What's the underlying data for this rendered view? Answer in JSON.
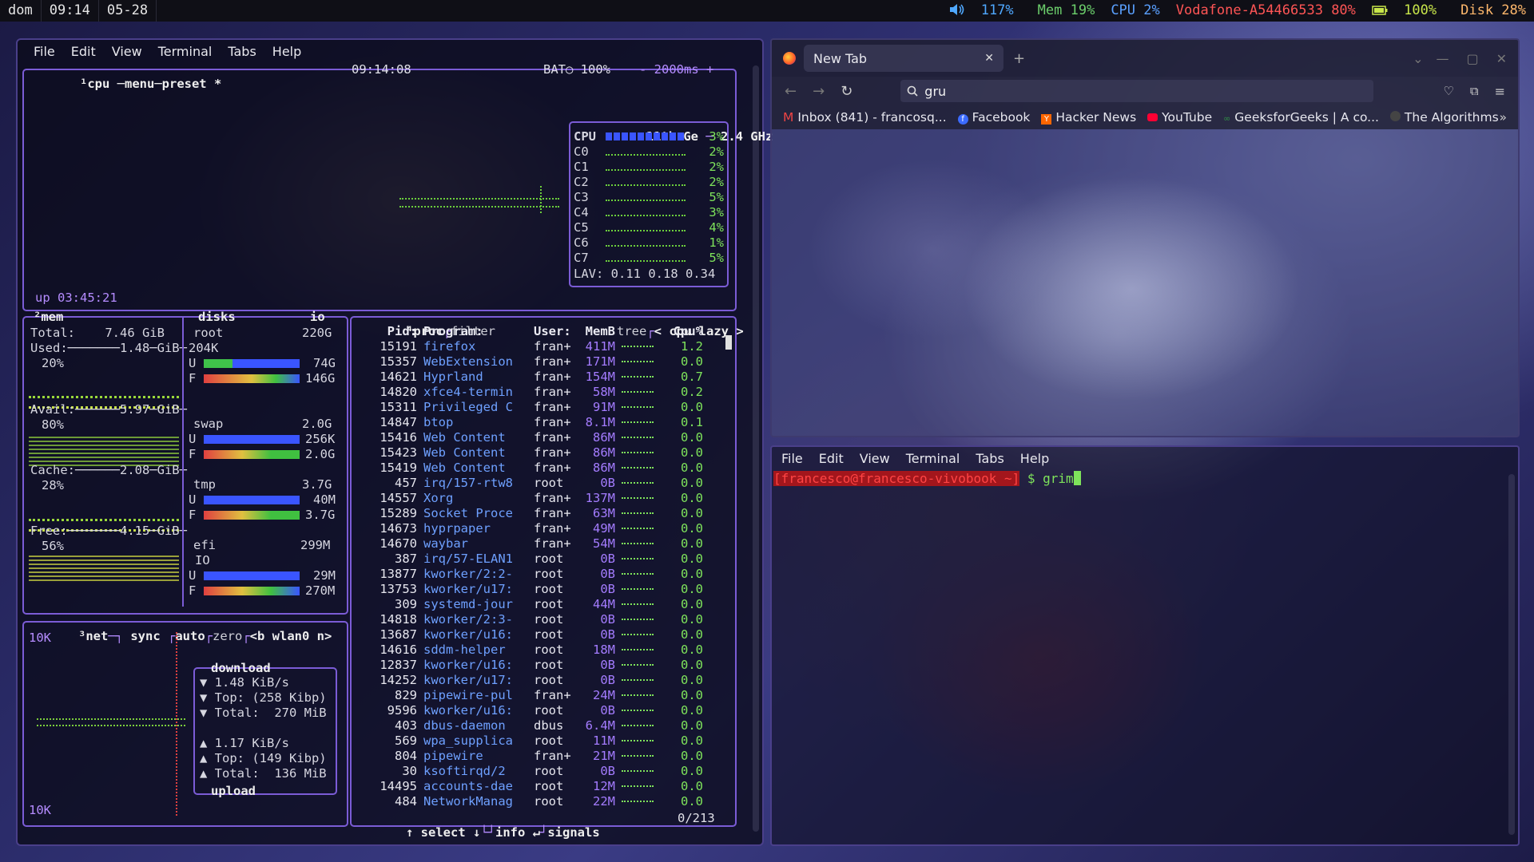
{
  "topbar": {
    "workspace": "dom",
    "time": "09:14",
    "date": "05-28",
    "volume": "117%",
    "mem": "Mem 19%",
    "cpu": "CPU  2%",
    "wifi": "Vodafone-A54466533 80%",
    "battery": "100%",
    "disk": "Disk 28%",
    "colors": {
      "volume": "#4fa8ff",
      "mem": "#6ccf6c",
      "cpu": "#5aa0ff",
      "wifi": "#ff5555",
      "battery": "#c8e64a",
      "disk": "#ffb86c"
    }
  },
  "term1": {
    "menu": [
      "File",
      "Edit",
      "View",
      "Terminal",
      "Tabs",
      "Help"
    ],
    "cpu_box": {
      "header": "¹cpu ─menu─preset *",
      "clock": "09:14:08",
      "bat": "BAT○ 100%",
      "interval": "- 2000ms +",
      "uptime": "up 03:45:21",
      "cpu_name": "11th Ge",
      "freq": "2.4 GHz",
      "cores": [
        {
          "name": "CPU",
          "pct": "3%"
        },
        {
          "name": "C0",
          "pct": "2%"
        },
        {
          "name": "C1",
          "pct": "2%"
        },
        {
          "name": "C2",
          "pct": "2%"
        },
        {
          "name": "C3",
          "pct": "5%"
        },
        {
          "name": "C4",
          "pct": "3%"
        },
        {
          "name": "C5",
          "pct": "4%"
        },
        {
          "name": "C6",
          "pct": "1%"
        },
        {
          "name": "C7",
          "pct": "5%"
        }
      ],
      "lav": "LAV: 0.11 0.18 0.34"
    },
    "mem_box": {
      "title": "²mem",
      "total": "Total:    7.46 GiB",
      "used": "Used:───────1.48─GiB─",
      "used_pct": "20%",
      "avail": "Avail:──────5.97─GiB─",
      "avail_pct": "80%",
      "cache": "Cache:──────2.08─GiB─",
      "cache_pct": "28%",
      "free": "Free:───────4.15─GiB─",
      "free_pct": "56%"
    },
    "disks_box": {
      "title": "disks",
      "io": "io",
      "root": "root",
      "root_size": "220G",
      "root_io": "204K",
      "root_u": "74G",
      "root_f": "146G",
      "swap": "swap",
      "swap_size": "2.0G",
      "swap_u": "256K",
      "swap_f": "2.0G",
      "tmp": "tmp",
      "tmp_size": "3.7G",
      "tmp_u": "40M",
      "tmp_f": "3.7G",
      "efi": "efi",
      "efi_size": "299M",
      "efi_io": "IO",
      "efi_u": "29M",
      "efi_f": "270M"
    },
    "net_box": {
      "header": "³net",
      "sync": "sync",
      "auto": "auto",
      "zero": "zero",
      "iface": "<b wlan0 n>",
      "scale_top": "10K",
      "scale_bottom": "10K",
      "download": "download",
      "dl_rate": "▼ 1.48 KiB/s",
      "dl_top": "▼ Top: (258 Kibp)",
      "dl_total": "▼ Total:  270 MiB",
      "ul_rate": "▲ 1.17 KiB/s",
      "ul_top": "▲ Top: (149 Kibp)",
      "ul_total": "▲ Total:  136 MiB",
      "upload": "upload"
    },
    "proc_box": {
      "title": "⁴proc",
      "filter": "filter",
      "tree": "tree",
      "sort": "< cpu lazy >",
      "headers": {
        "pid": "Pid:",
        "program": "Program:",
        "user": "User:",
        "mem": "MemB",
        "cpu": "Cpu%"
      },
      "rows": [
        {
          "pid": "15191",
          "prog": "firefox",
          "user": "fran+",
          "mem": "411M",
          "cpu": "1.2"
        },
        {
          "pid": "15357",
          "prog": "WebExtension",
          "user": "fran+",
          "mem": "171M",
          "cpu": "0.0"
        },
        {
          "pid": "14621",
          "prog": "Hyprland",
          "user": "fran+",
          "mem": "154M",
          "cpu": "0.7"
        },
        {
          "pid": "14820",
          "prog": "xfce4-termin",
          "user": "fran+",
          "mem": "58M",
          "cpu": "0.2"
        },
        {
          "pid": "15311",
          "prog": "Privileged C",
          "user": "fran+",
          "mem": "91M",
          "cpu": "0.0"
        },
        {
          "pid": "14847",
          "prog": "btop",
          "user": "fran+",
          "mem": "8.1M",
          "cpu": "0.1"
        },
        {
          "pid": "15416",
          "prog": "Web Content",
          "user": "fran+",
          "mem": "86M",
          "cpu": "0.0"
        },
        {
          "pid": "15423",
          "prog": "Web Content",
          "user": "fran+",
          "mem": "86M",
          "cpu": "0.0"
        },
        {
          "pid": "15419",
          "prog": "Web Content",
          "user": "fran+",
          "mem": "86M",
          "cpu": "0.0"
        },
        {
          "pid": "457",
          "prog": "irq/157-rtw8",
          "user": "root",
          "mem": "0B",
          "cpu": "0.0"
        },
        {
          "pid": "14557",
          "prog": "Xorg",
          "user": "fran+",
          "mem": "137M",
          "cpu": "0.0"
        },
        {
          "pid": "15289",
          "prog": "Socket Proce",
          "user": "fran+",
          "mem": "63M",
          "cpu": "0.0"
        },
        {
          "pid": "14673",
          "prog": "hyprpaper",
          "user": "fran+",
          "mem": "49M",
          "cpu": "0.0"
        },
        {
          "pid": "14670",
          "prog": "waybar",
          "user": "fran+",
          "mem": "54M",
          "cpu": "0.0"
        },
        {
          "pid": "387",
          "prog": "irq/57-ELAN1",
          "user": "root",
          "mem": "0B",
          "cpu": "0.0"
        },
        {
          "pid": "13877",
          "prog": "kworker/2:2-",
          "user": "root",
          "mem": "0B",
          "cpu": "0.0"
        },
        {
          "pid": "13753",
          "prog": "kworker/u17:",
          "user": "root",
          "mem": "0B",
          "cpu": "0.0"
        },
        {
          "pid": "309",
          "prog": "systemd-jour",
          "user": "root",
          "mem": "44M",
          "cpu": "0.0"
        },
        {
          "pid": "14818",
          "prog": "kworker/2:3-",
          "user": "root",
          "mem": "0B",
          "cpu": "0.0"
        },
        {
          "pid": "13687",
          "prog": "kworker/u16:",
          "user": "root",
          "mem": "0B",
          "cpu": "0.0"
        },
        {
          "pid": "14616",
          "prog": "sddm-helper",
          "user": "root",
          "mem": "18M",
          "cpu": "0.0"
        },
        {
          "pid": "12837",
          "prog": "kworker/u16:",
          "user": "root",
          "mem": "0B",
          "cpu": "0.0"
        },
        {
          "pid": "14252",
          "prog": "kworker/u17:",
          "user": "root",
          "mem": "0B",
          "cpu": "0.0"
        },
        {
          "pid": "829",
          "prog": "pipewire-pul",
          "user": "fran+",
          "mem": "24M",
          "cpu": "0.0"
        },
        {
          "pid": "9596",
          "prog": "kworker/u16:",
          "user": "root",
          "mem": "0B",
          "cpu": "0.0"
        },
        {
          "pid": "403",
          "prog": "dbus-daemon",
          "user": "dbus",
          "mem": "6.4M",
          "cpu": "0.0"
        },
        {
          "pid": "569",
          "prog": "wpa_supplica",
          "user": "root",
          "mem": "11M",
          "cpu": "0.0"
        },
        {
          "pid": "804",
          "prog": "pipewire",
          "user": "fran+",
          "mem": "21M",
          "cpu": "0.0"
        },
        {
          "pid": "30",
          "prog": "ksoftirqd/2",
          "user": "root",
          "mem": "0B",
          "cpu": "0.0"
        },
        {
          "pid": "14495",
          "prog": "accounts-dae",
          "user": "root",
          "mem": "12M",
          "cpu": "0.0"
        },
        {
          "pid": "484",
          "prog": "NetworkManag",
          "user": "root",
          "mem": "22M",
          "cpu": "0.0"
        }
      ],
      "footer_select": "↑ select ↓",
      "footer_info": "info ↵",
      "footer_signals": "signals",
      "count": "0/213"
    }
  },
  "firefox": {
    "tab_title": "New Tab",
    "address": "gru",
    "bookmarks": [
      "Inbox (841) - francosq...",
      "Facebook",
      "Hacker News",
      "YouTube",
      "GeeksforGeeks | A co...",
      "The Algorithms"
    ]
  },
  "term2": {
    "menu": [
      "File",
      "Edit",
      "View",
      "Terminal",
      "Tabs",
      "Help"
    ],
    "prompt": "[francesco@francesco-vivobook ~]",
    "command": "$ grim"
  }
}
